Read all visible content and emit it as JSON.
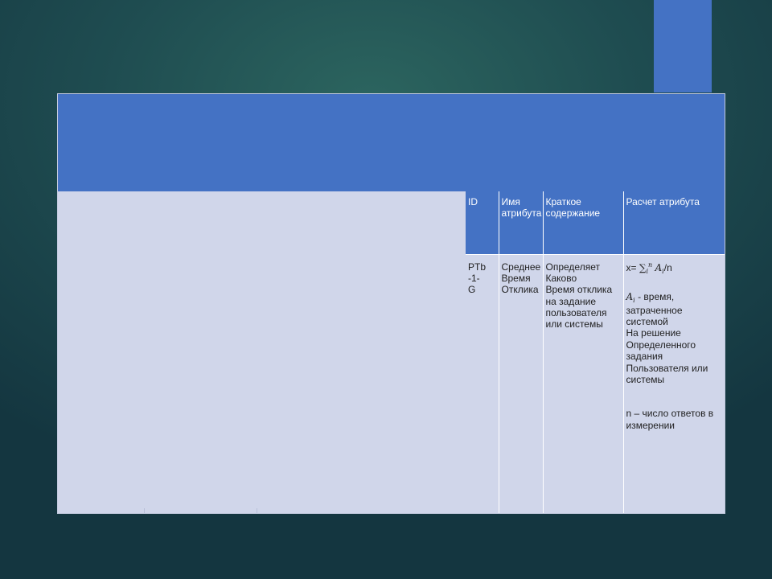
{
  "colors": {
    "accent": "#4472c4",
    "table_body": "#d0d6ea",
    "background_dark": "#143640",
    "background_light": "#2c655f"
  },
  "table": {
    "headers": [
      "ID",
      "Имя атрибута",
      "Краткое содержание",
      "Расчет атрибута"
    ],
    "row": {
      "id": "PTb -1-\nG",
      "name": "Среднее\nВремя\nОтклика",
      "summary": "Определяет\nКаково\nВремя отклика\nна задание\nпользователя\nили системы",
      "formula": {
        "lhs": "x=",
        "sum_symbol": "∑",
        "sum_sub": "i",
        "sum_sup": "n",
        "var": "A",
        "var_sub": "i",
        "tail": "/n"
      },
      "definition_var": "A",
      "definition_var_sub": "i",
      "definition_text": " - время,\nзатраченное системой\nНа решение\nОпределенного\n задания\nПользователя или\nсистемы",
      "note": " n – число ответов в\nизмерении"
    }
  }
}
